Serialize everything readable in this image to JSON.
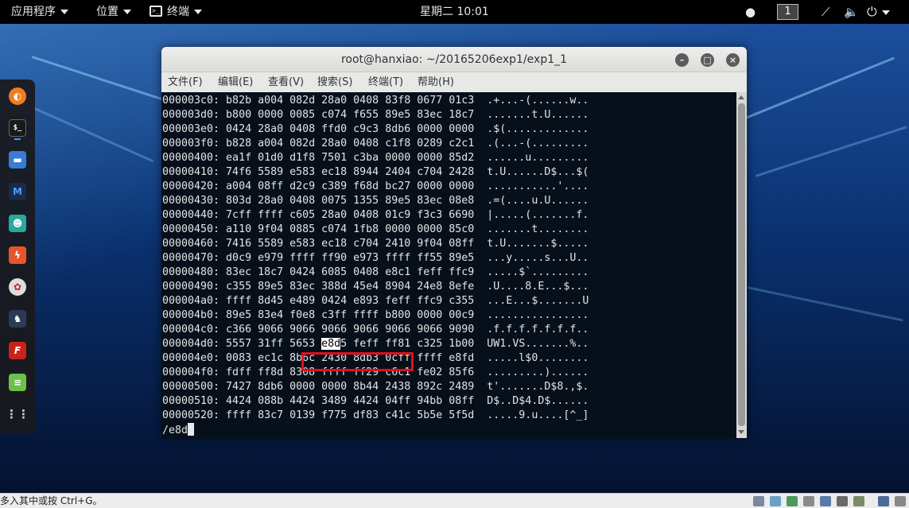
{
  "topbar": {
    "applications": "应用程序",
    "places": "位置",
    "terminal": "终端",
    "clock": "星期二 10:01",
    "workspace": "1"
  },
  "window": {
    "title": "root@hanxiao: ~/20165206exp1/exp1_1",
    "menu": [
      "文件(F)",
      "编辑(E)",
      "查看(V)",
      "搜索(S)",
      "终端(T)",
      "帮助(H)"
    ]
  },
  "terminal": {
    "lines": [
      "000003c0: b82b a004 082d 28a0 0408 83f8 0677 01c3  .+...-(......w..",
      "000003d0: b800 0000 0085 c074 f655 89e5 83ec 18c7  .......t.U......",
      "000003e0: 0424 28a0 0408 ffd0 c9c3 8db6 0000 0000  .$(.............",
      "000003f0: b828 a004 082d 28a0 0408 c1f8 0289 c2c1  .(...-(.........",
      "00000400: ea1f 01d0 d1f8 7501 c3ba 0000 0000 85d2  ......u.........",
      "00000410: 74f6 5589 e583 ec18 8944 2404 c704 2428  t.U......D$...$(",
      "00000420: a004 08ff d2c9 c389 f68d bc27 0000 0000  ...........'....",
      "00000430: 803d 28a0 0408 0075 1355 89e5 83ec 08e8  .=(....u.U......",
      "00000440: 7cff ffff c605 28a0 0408 01c9 f3c3 6690  |.....(.......f.",
      "00000450: a110 9f04 0885 c074 1fb8 0000 0000 85c0  .......t........",
      "00000460: 7416 5589 e583 ec18 c704 2410 9f04 08ff  t.U.......$.....",
      "00000470: d0c9 e979 ffff ff90 e973 ffff ff55 89e5  ...y.....s...U..",
      "00000480: 83ec 18c7 0424 6085 0408 e8c1 feff ffc9  .....$`.........",
      "00000490: c355 89e5 83ec 388d 45e4 8904 24e8 8efe  .U....8.E...$...",
      "000004a0: ffff 8d45 e489 0424 e893 feff ffc9 c355  ...E...$.......U",
      "000004b0: 89e5 83e4 f0e8 c3ff ffff b800 0000 00c9  ................",
      "000004c0: c366 9066 9066 9066 9066 9066 9066 9090  .f.f.f.f.f.f.f..",
      "000004e0: 0083 ec1c 8b6c 2430 8db3 0cff ffff e8fd  .....l$0........",
      "000004f0: fdff ff8d 8308 ffff ff29 c6c1 fe02 85f6  .........)......",
      "00000500: 7427 8db6 0000 0000 8b44 2438 892c 2489  t'.......D$8.,$.",
      "00000510: 4424 088b 4424 3489 4424 04ff 94bb 08ff  D$..D$4.D$......",
      "00000520: ffff 83c7 0139 f775 df83 c41c 5b5e 5f5d  .....9.u....[^_]"
    ],
    "line_4d0_before": "000004d0: 5557 31ff 5653 ",
    "line_4d0_match": "e8d",
    "line_4d0_after": "5 feff ff81 c325 1b00  UW1.VS.......%..",
    "prompt": "/e8d"
  },
  "statusbar": {
    "text": "多入其中或按 Ctrl+G。"
  }
}
